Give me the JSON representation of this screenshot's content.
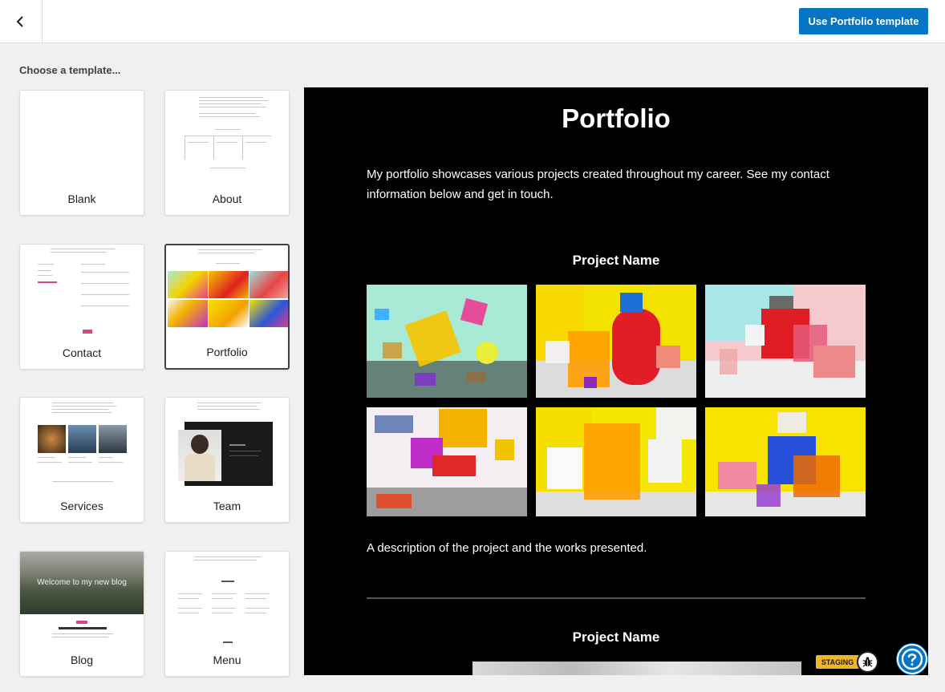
{
  "header": {
    "back_icon": "chevron-left-icon",
    "use_template_label": "Use Portfolio template"
  },
  "sidebar": {
    "heading": "Choose a template...",
    "templates": [
      {
        "label": "Blank"
      },
      {
        "label": "About"
      },
      {
        "label": "Contact"
      },
      {
        "label": "Portfolio",
        "selected": true
      },
      {
        "label": "Services"
      },
      {
        "label": "Team"
      },
      {
        "label": "Blog",
        "overlay": "Welcome to my new blog"
      },
      {
        "label": "Menu"
      }
    ]
  },
  "preview": {
    "title": "Portfolio",
    "intro": "My portfolio showcases various projects created throughout my career. See my contact information below and get in touch.",
    "project_heading_1": "Project Name",
    "project_description": "A description of the project and the works presented.",
    "project_heading_2": "Project Name"
  },
  "badges": {
    "staging_label": "STAGING",
    "bug_icon": "bug-icon",
    "help_icon": "help-icon"
  },
  "colors": {
    "accent": "#0675c4",
    "staging": "#f0b429",
    "preview_bg": "#000000"
  }
}
